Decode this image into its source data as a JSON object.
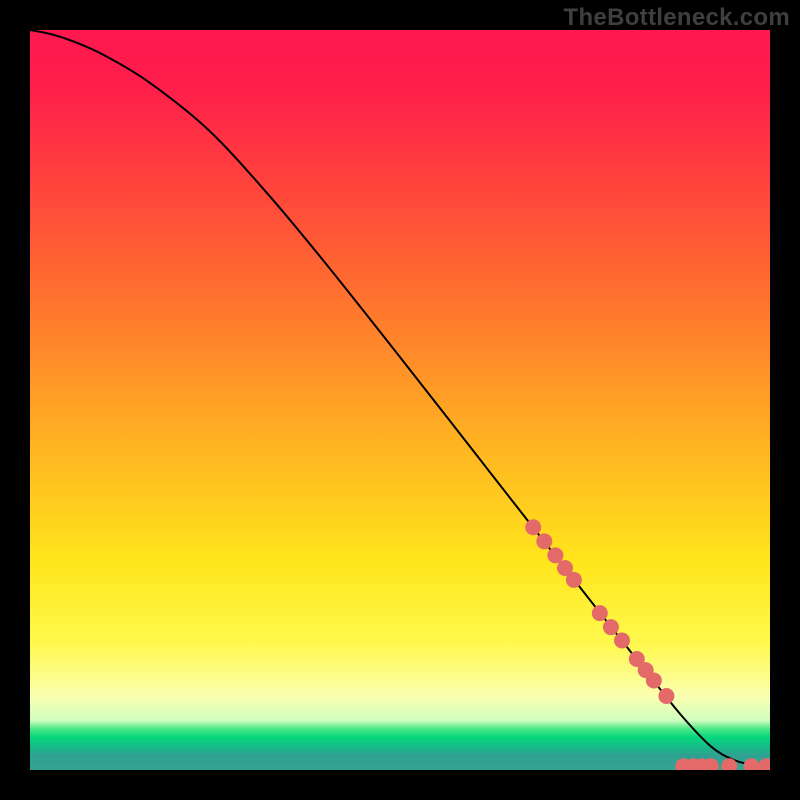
{
  "watermark": "TheBottleneck.com",
  "chart_data": {
    "type": "line",
    "title": "",
    "xlabel": "",
    "ylabel": "",
    "xlim": [
      0,
      100
    ],
    "ylim": [
      0,
      100
    ],
    "grid": false,
    "series": [
      {
        "name": "curve",
        "x": [
          0,
          3,
          6,
          10,
          16,
          24,
          32,
          40,
          50,
          60,
          70,
          78,
          84,
          88,
          92,
          95,
          98,
          100
        ],
        "y": [
          100,
          99.4,
          98.4,
          96.6,
          93.0,
          86.6,
          78.0,
          68.4,
          55.8,
          43.0,
          30.2,
          20.0,
          12.4,
          7.4,
          3.2,
          1.4,
          0.6,
          0.4
        ],
        "stroke": "#000000",
        "stroke_width": 2
      }
    ],
    "markers": {
      "name": "dots",
      "color": "#e46a6a",
      "radius_px": 8,
      "points": [
        {
          "x": 68.0,
          "y": 32.8
        },
        {
          "x": 69.5,
          "y": 30.9
        },
        {
          "x": 71.0,
          "y": 29.0
        },
        {
          "x": 72.3,
          "y": 27.3
        },
        {
          "x": 73.5,
          "y": 25.7
        },
        {
          "x": 77.0,
          "y": 21.2
        },
        {
          "x": 78.5,
          "y": 19.3
        },
        {
          "x": 80.0,
          "y": 17.5
        },
        {
          "x": 82.0,
          "y": 15.0
        },
        {
          "x": 83.2,
          "y": 13.5
        },
        {
          "x": 84.3,
          "y": 12.1
        },
        {
          "x": 86.0,
          "y": 10.0
        },
        {
          "x": 88.3,
          "y": 0.5
        },
        {
          "x": 89.6,
          "y": 0.5
        },
        {
          "x": 90.8,
          "y": 0.5
        },
        {
          "x": 92.0,
          "y": 0.5
        },
        {
          "x": 94.5,
          "y": 0.5
        },
        {
          "x": 97.5,
          "y": 0.5
        },
        {
          "x": 99.5,
          "y": 0.5
        }
      ]
    },
    "gradient_stops": [
      {
        "pos": 0.0,
        "color": "#ff1850"
      },
      {
        "pos": 0.35,
        "color": "#ff6e2f"
      },
      {
        "pos": 0.72,
        "color": "#ffe61c"
      },
      {
        "pos": 0.9,
        "color": "#fbffb0"
      },
      {
        "pos": 0.955,
        "color": "#04d57b"
      },
      {
        "pos": 1.0,
        "color": "#35a38f"
      }
    ]
  }
}
